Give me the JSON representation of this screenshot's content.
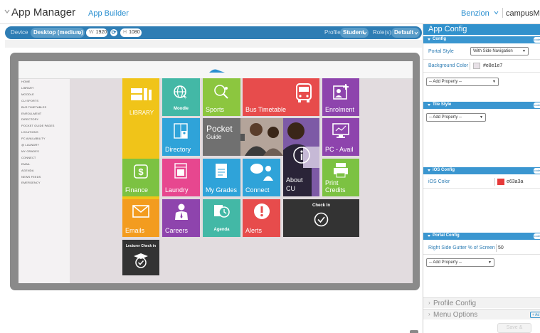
{
  "header": {
    "title": "App Manager",
    "subtitle": "App Builder",
    "user": "Benzion",
    "campus": "campusM"
  },
  "toolbar": {
    "device_label": "Device",
    "device_value": "Desktop (medium)",
    "width_key": "W",
    "width_value": "1920",
    "height_key": "H",
    "height_value": "1080",
    "profile_label": "Profile",
    "profile_value": "Student",
    "roles_label": "Role(s)",
    "roles_value": "Default"
  },
  "nav": {
    "items": [
      "HOME",
      "LIBRARY",
      "MOODLE",
      "CU SPORTS",
      "BUS TIMETABLES",
      "ENROLLMENT",
      "DIRECTORY",
      "POCKET GUIDE PAGES",
      "LOCATIONS",
      "PC AVAILABILITY",
      "@ LAUNDRY",
      "MY GRADES",
      "CONNECT",
      "EMAIL",
      "AGENDA",
      "NEWS FEEDS",
      "EMERGENCY"
    ]
  },
  "tiles": {
    "library": "LIBRARY",
    "moodle": "Moodle",
    "sports": "Sports",
    "bus": "Bus Timetable",
    "enrolment": "Enrolment",
    "directory": "Directory",
    "pocket_title": "Pocket",
    "pocket_sub": "Guide",
    "pc_avail": "PC - Avail",
    "finance": "Finance",
    "laundry": "Laundry",
    "grades": "My Grades",
    "connect": "Connect",
    "about_1": "About",
    "about_2": "CU",
    "print_1": "Print",
    "print_2": "Credits",
    "emails": "Emails",
    "careers": "Careers",
    "agenda": "Agenda",
    "alerts": "Alerts",
    "checkin": "Check In",
    "lecturer": "Lecturer Check in"
  },
  "panel": {
    "title": "App Config",
    "config_header": "Config",
    "code_label": "code",
    "portal_style_label": "Portal Style",
    "portal_style_value": "With Side Navigation",
    "bg_color_label": "Background Color",
    "bg_color_value": "#e8e1e7",
    "add_property": "-- Add Property --",
    "tile_style_header": "Tile Style",
    "ios_header": "iOS Config",
    "ios_color_label": "iOS Color",
    "ios_color_value": "e63a3a",
    "portal_config_header": "Portal Config",
    "gutter_label": "Right Side Gutter % of Screen",
    "gutter_value": "50",
    "profile_config": "Profile Config",
    "menu_options": "Menu Options",
    "add_label": "+ Ad",
    "save_label": "Save &"
  },
  "colors": {
    "accent": "#3191cc",
    "bg_swatch": "#e8e1e7",
    "ios_swatch": "#e63a3a",
    "library": "#f0c419",
    "moodle": "#43b8a6",
    "sports": "#8cc63f",
    "bus": "#e74c4c",
    "enrolment": "#8e44ad",
    "directory": "#2fa3d9",
    "finance": "#7cc242",
    "laundry": "#e7478f",
    "grades": "#2fa3d9",
    "connect": "#2fa3d9",
    "print": "#7cc242",
    "emails": "#f39c1f",
    "careers": "#8e44ad",
    "agenda": "#43b8a6",
    "alerts": "#e74c4c",
    "dark": "#333333"
  }
}
